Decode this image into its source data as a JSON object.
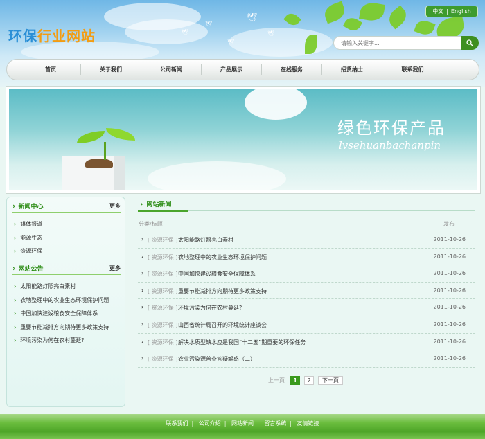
{
  "site": {
    "logo_part1": "环保",
    "logo_part2": "行业网站"
  },
  "lang": {
    "zh": "中文",
    "sep": "|",
    "en": "English"
  },
  "search": {
    "placeholder": "请输入关键字..."
  },
  "nav": {
    "items": [
      "首页",
      "关于我们",
      "公司新闻",
      "产品展示",
      "在线服务",
      "招贤纳士",
      "联系我们"
    ]
  },
  "banner": {
    "title": "绿色环保产品",
    "subtitle": "lvsehuanbachanpin"
  },
  "sidebar": {
    "news_center": {
      "title": "新闻中心",
      "more": "更多",
      "items": [
        "媒体报道",
        "能源生态",
        "资源环保"
      ]
    },
    "announcements": {
      "title": "网站公告",
      "more": "更多",
      "items": [
        "太阳能路灯照亮白素村",
        "农地整理中的农业生态环境保护问题",
        "中国加快建设粮食安全保障体系",
        "重要节能减排方向期待更多政策支持",
        "环境污染为何在农村蔓延?"
      ]
    }
  },
  "main": {
    "title": "网站新闻",
    "col_category_title": "分类/标题",
    "col_date": "发布",
    "rows": [
      {
        "category": "[ 资源环保 ]",
        "title": "太阳能路灯照亮白素村",
        "date": "2011-10-26"
      },
      {
        "category": "[ 资源环保 ]",
        "title": "农地整理中的农业生态环境保护问题",
        "date": "2011-10-26"
      },
      {
        "category": "[ 资源环保 ]",
        "title": "中国加快建设粮食安全保障体系",
        "date": "2011-10-26"
      },
      {
        "category": "[ 资源环保 ]",
        "title": "重要节能减排方向期待更多政策支持",
        "date": "2011-10-26"
      },
      {
        "category": "[ 资源环保 ]",
        "title": "环境污染为何在农村蔓延?",
        "date": "2011-10-26"
      },
      {
        "category": "[ 资源环保 ]",
        "title": "山西省统计局召开的环境统计座谈会",
        "date": "2011-10-26"
      },
      {
        "category": "[ 资源环保 ]",
        "title": "解决水质型缺水应是我国“十二五”期重要的环保任务",
        "date": "2011-10-26"
      },
      {
        "category": "[ 资源环保 ]",
        "title": "农业污染源普查答疑解惑（二）",
        "date": "2011-10-26"
      }
    ],
    "arrow": "›"
  },
  "pager": {
    "prev": "上一页",
    "pages": [
      "1",
      "2"
    ],
    "current": "1",
    "next": "下一页"
  },
  "footer": {
    "links": [
      "联系我们",
      "公司介绍",
      "网站新闻",
      "留言系统",
      "友情链接"
    ],
    "sep": "|"
  },
  "colors": {
    "accent_green": "#3a9a1d",
    "logo_blue": "#2a8fd6",
    "logo_orange": "#f39c12"
  }
}
